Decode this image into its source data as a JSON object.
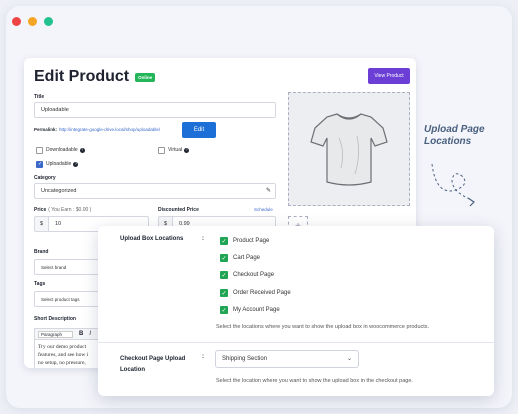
{
  "colors": {
    "dot_red": "#ef4444",
    "dot_orange": "#f5a524",
    "dot_green": "#21c28e",
    "accent": "#6b3fd6",
    "edit_blue": "#1c6fd6",
    "check_green": "#1fa553",
    "badge_green": "#22b55a"
  },
  "edit_product": {
    "title": "Edit Product",
    "badge": "Online",
    "view_button": "View Product",
    "title_label": "Title",
    "title_value": "Uploadable",
    "permalink_label": "Permalink:",
    "permalink_url": "http://integrate-google-drive.local/shop/uploadable/",
    "edit_button": "Edit",
    "downloadable_label": "Downloadable",
    "virtual_label": "Virtual",
    "uploadable_label": "Uploadable",
    "category_label": "Category",
    "category_value": "Uncategorized",
    "price_label": "Price",
    "price_note": "( You Earn : $0.00 )",
    "currency": "$",
    "price_value": "10",
    "discounted_label": "Discounted Price",
    "schedule_link": "Schedule",
    "discounted_value": "0.99",
    "brand_label": "Brand",
    "brand_placeholder": "Select brand",
    "tags_label": "Tags",
    "tags_placeholder": "Select product tags",
    "short_desc_label": "Short Description",
    "paragraph_select": "Paragraph",
    "bold_btn": "B",
    "italic_btn": "I",
    "desc_line1": "Try our demo product",
    "desc_line2": "features, and see how i",
    "desc_line3": "no setup, no pressure, "
  },
  "upload_panel": {
    "locations_label": "Upload Box Locations",
    "colon": ":",
    "options": [
      "Product Page",
      "Cart Page",
      "Checkout Page",
      "Order Received Page",
      "My Account Page"
    ],
    "locations_help": "Select the locations where you want to show the upload box in woocommerce products.",
    "checkout_label_line1": "Checkout Page Upload",
    "checkout_label_line2": "Location",
    "checkout_select": "Shipping Section",
    "checkout_help": "Select the location where you want to show the upload box in the checkout page."
  },
  "annotation": {
    "line1": "Upload Page",
    "line2": "Locations"
  }
}
